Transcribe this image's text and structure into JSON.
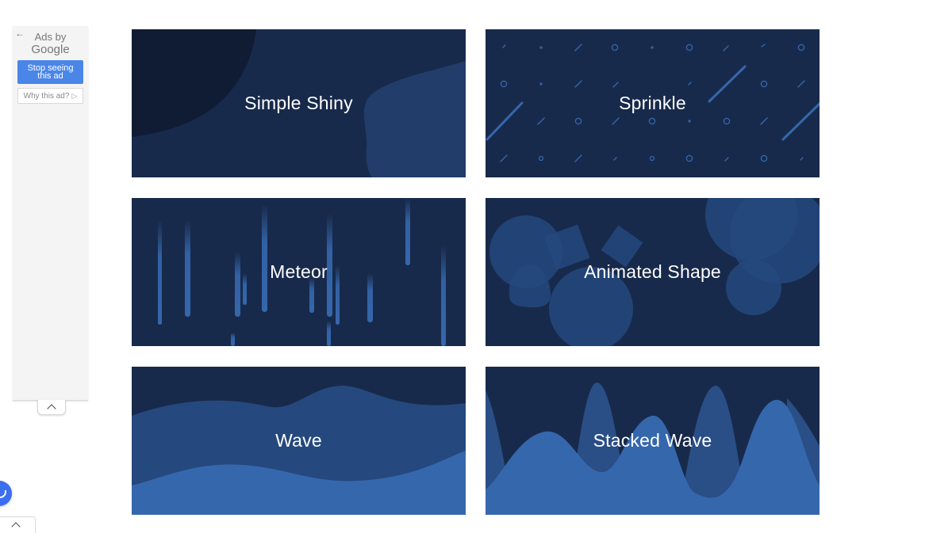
{
  "ad": {
    "ads_by": "Ads by",
    "google": "Google",
    "stop_button": "Stop seeing this ad",
    "why_button": "Why this ad?",
    "back_icon": "arrow-left-icon",
    "why_icon": "triangle-right-icon",
    "collapse_icon": "chevron-up-icon"
  },
  "cards": [
    {
      "label": "Simple Shiny"
    },
    {
      "label": "Sprinkle"
    },
    {
      "label": "Meteor"
    },
    {
      "label": "Animated Shape"
    },
    {
      "label": "Wave"
    },
    {
      "label": "Stacked Wave"
    }
  ],
  "widgets": {
    "chat_icon": "chat-bubble-icon",
    "bottom_tab_icon": "chevron-up-icon"
  },
  "colors": {
    "card_bg": "#182a4b",
    "accent_blue": "#3567ad",
    "mid_blue": "#25487e",
    "ad_button": "#4a86e8"
  }
}
